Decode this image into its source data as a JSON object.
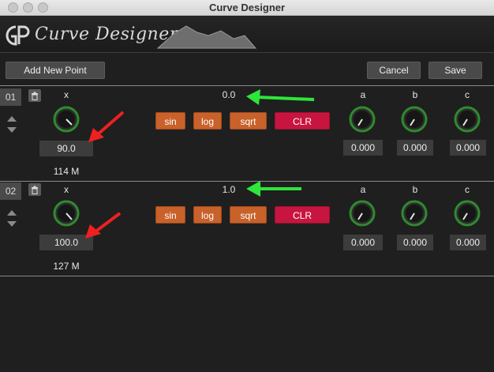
{
  "window": {
    "title": "Curve Designer"
  },
  "header": {
    "logo_text": "Curve Designer"
  },
  "toolbar": {
    "add_label": "Add New Point",
    "cancel_label": "Cancel",
    "save_label": "Save"
  },
  "points": [
    {
      "number": "01",
      "x_label": "x",
      "y_value": "0.0",
      "x_value": "90.0",
      "sub_value": "114 M",
      "functions": [
        "sin",
        "log",
        "sqrt",
        "CLR"
      ],
      "params": [
        {
          "label": "a",
          "value": "0.000"
        },
        {
          "label": "b",
          "value": "0.000"
        },
        {
          "label": "c",
          "value": "0.000"
        }
      ]
    },
    {
      "number": "02",
      "x_label": "x",
      "y_value": "1.0",
      "x_value": "100.0",
      "sub_value": "127 M",
      "functions": [
        "sin",
        "log",
        "sqrt",
        "CLR"
      ],
      "params": [
        {
          "label": "a",
          "value": "0.000"
        },
        {
          "label": "b",
          "value": "0.000"
        },
        {
          "label": "c",
          "value": "0.000"
        }
      ]
    }
  ],
  "colors": {
    "knob_ring": "#2f8a2f",
    "func_orange": "#c8612a",
    "func_clear": "#c8153f",
    "annotation_green": "#2ee63a",
    "annotation_red": "#ee2020"
  }
}
